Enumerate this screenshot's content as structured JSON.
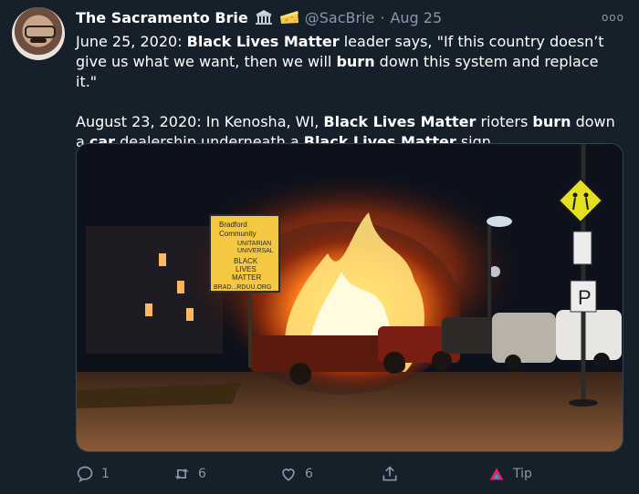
{
  "tweet": {
    "author_name": "The Sacramento Brie",
    "emojis": [
      "classical-building-icon",
      "cheese-icon"
    ],
    "handle": "@SacBrie",
    "separator": "·",
    "time": "Aug 25",
    "more_label": "ooo",
    "paragraph1": {
      "s1": "June 25, 2020: ",
      "b1": "Black Lives Matter",
      "s2": " leader says, \"If this country doesn’t give us what we want, then we will ",
      "b2": "burn",
      "s3": " down this system and replace it.\""
    },
    "paragraph2": {
      "s1": "August 23, 2020: In Kenosha, WI, ",
      "b1": "Black Lives Matter",
      "s2": " rioters ",
      "b2": "burn",
      "s3": " down a ",
      "b3": "car",
      "s4": " dealership underneath a ",
      "b4": "Black Lives Matter",
      "s5": " sign."
    },
    "media": {
      "sign_lines": [
        "Bradford",
        "Community",
        "UNITARIAN",
        "UNIVERSAL",
        "BLACK",
        "LIVES",
        "MATTER",
        "BRAD...RDUU.ORG"
      ],
      "parking_sign": "P"
    },
    "actions": {
      "reply_count": "1",
      "retweet_count": "6",
      "like_count": "6",
      "tip_label": "Tip"
    }
  },
  "colors": {
    "background": "#15202b",
    "muted": "#8899a6",
    "tip_accent": "#e0245e"
  }
}
